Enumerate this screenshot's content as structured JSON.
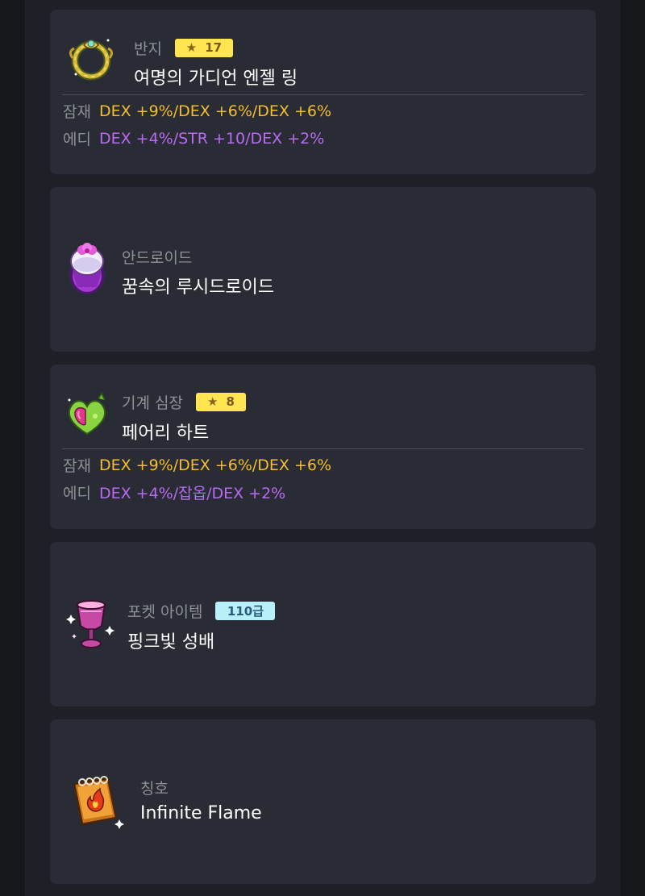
{
  "colors": {
    "potential": "#f5be2f",
    "additional": "#b86bf1",
    "star_badge": "#ffe54f",
    "grade_badge": "#b7f0fb"
  },
  "cards": [
    {
      "category": "반지",
      "badge": "17",
      "name": "여명의 가디언 엔젤 링",
      "icon": "ring-icon",
      "options": {
        "pot_label": "잠재",
        "pot_value": "DEX +9%/DEX +6%/DEX +6%",
        "add_label": "에디",
        "add_value": "DEX +4%/STR +10/DEX +2%"
      }
    },
    {
      "category": "안드로이드",
      "name": "꿈속의 루시드로이드",
      "icon": "android-icon"
    },
    {
      "category": "기계 심장",
      "badge": "8",
      "name": "페어리 하트",
      "icon": "heart-icon",
      "options": {
        "pot_label": "잠재",
        "pot_value": "DEX +9%/DEX +6%/DEX +6%",
        "add_label": "에디",
        "add_value": "DEX +4%/잡옵/DEX +2%"
      }
    },
    {
      "category": "포켓 아이템",
      "badge": "110급",
      "name": "핑크빛 성배",
      "icon": "chalice-icon"
    },
    {
      "category": "칭호",
      "name": "Infinite Flame",
      "icon": "title-book-icon"
    }
  ]
}
